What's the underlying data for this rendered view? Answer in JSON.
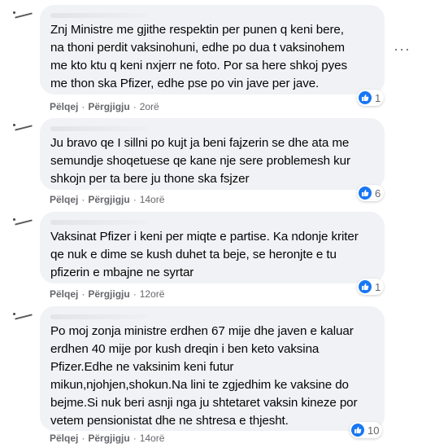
{
  "actions": {
    "like": "Pëlqej",
    "reply": "Përgjigju",
    "separator": "·"
  },
  "colors": {
    "bubble": "#f0f2f5",
    "like_blue": "#1877f2",
    "meta_gray": "#65676b"
  },
  "more_icon": "more-options-icon",
  "comments": [
    {
      "text": "Znj Ministre me gjithe respektin per punen q keni bere,\nna thoni perdit vaksinohuni, edhe po dua t vaksinohem\nme kto ktu q keni nxjerr ne foto. Por sa here shkoj pyes\nme thon ska Pfizer, edhe pse po vin jave per jave.",
      "time": "2orë",
      "reactions": "1"
    },
    {
      "text": "Ju bravo qe I sillni po kujt ja beni fajzerin se dhe ata me\nsemundje shoqetuese qe kane nje sere problemesh kur\nshkojn per ta bere ju thone ska fsjzer",
      "time": "14orë",
      "reactions": "6"
    },
    {
      "text": "Vaksinat Pfizer i keni per miqte e partise. Ka ndonje kriter\nqe nuk e dime se kush duhet ta beje, se heronjte e tu\npfizerin e mbajne ne syrtar",
      "time": "12orë",
      "reactions": "1"
    },
    {
      "text": "Po moj zonja ministre erdhen 67 mije dhe javen e kaluar\nerdhen 40 mije por kush dreqin i ben keto vaksina\nPfizer.Edhe ne vaksinim keni futur\nmikun,njohjen,shokun.Na lini te zgjedhim ke vaksine do\nbejme.Si nuk beri asnji nga ju shtetaret vaksin kineze por\nvetem pensionistat dhe ne shtresa e thjesht.",
      "time": "14orë",
      "reactions": "10"
    }
  ]
}
